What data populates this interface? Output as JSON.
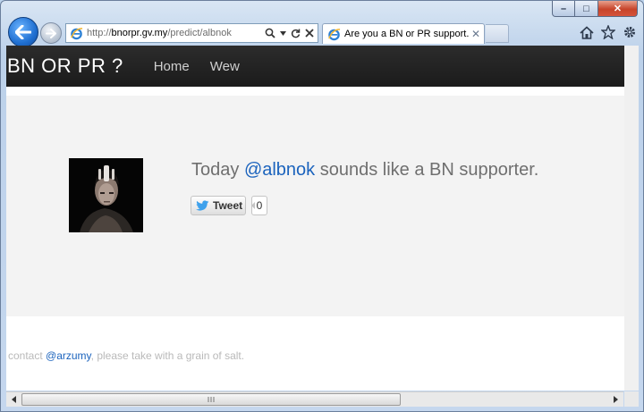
{
  "window": {
    "minimize_label": "–",
    "maximize_label": "□",
    "close_label": "✕"
  },
  "address_bar": {
    "url_prefix": "http://",
    "url_domain": "bnorpr.gv.my",
    "url_path": "/predict/albnok",
    "icons": [
      "search-icon",
      "dropdown-icon",
      "refresh-icon",
      "stop-icon"
    ]
  },
  "tab": {
    "title": "Are you a BN or PR support...",
    "close_label": "✕"
  },
  "toolbar_icons": [
    "home-icon",
    "favorites-icon",
    "tools-icon"
  ],
  "site": {
    "brand": "BN OR PR ?",
    "nav": [
      "Home",
      "Wew"
    ],
    "headline_prefix": "Today ",
    "headline_user": "@albnok",
    "headline_suffix": " sounds like a BN supporter.",
    "tweet_label": "Tweet",
    "tweet_count": "0",
    "footer_prefix": "contact ",
    "footer_user": "@arzumy",
    "footer_suffix": ", please take with a grain of salt."
  },
  "colors": {
    "navbar": "#1b1b1b",
    "link": "#1b63bd",
    "hero_bg": "#f3f3f3"
  }
}
